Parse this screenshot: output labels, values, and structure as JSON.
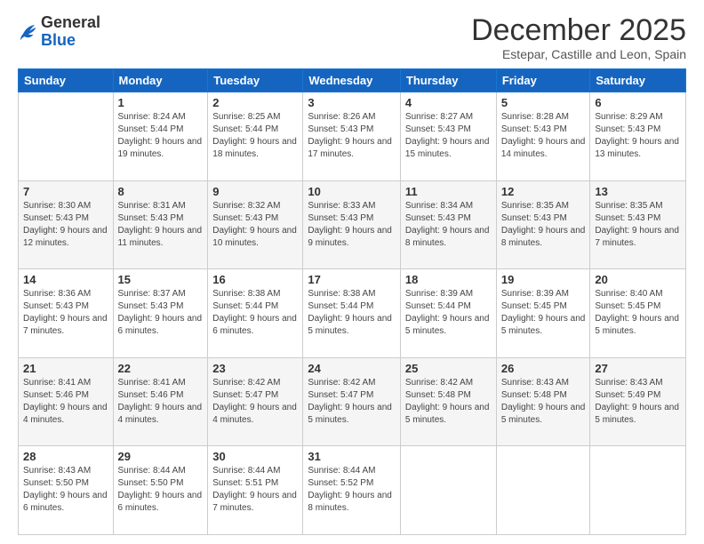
{
  "logo": {
    "general": "General",
    "blue": "Blue"
  },
  "header": {
    "month": "December 2025",
    "location": "Estepar, Castille and Leon, Spain"
  },
  "days_of_week": [
    "Sunday",
    "Monday",
    "Tuesday",
    "Wednesday",
    "Thursday",
    "Friday",
    "Saturday"
  ],
  "weeks": [
    [
      {
        "day": null
      },
      {
        "day": "1",
        "sunrise": "8:24 AM",
        "sunset": "5:44 PM",
        "daylight": "9 hours and 19 minutes."
      },
      {
        "day": "2",
        "sunrise": "8:25 AM",
        "sunset": "5:44 PM",
        "daylight": "9 hours and 18 minutes."
      },
      {
        "day": "3",
        "sunrise": "8:26 AM",
        "sunset": "5:43 PM",
        "daylight": "9 hours and 17 minutes."
      },
      {
        "day": "4",
        "sunrise": "8:27 AM",
        "sunset": "5:43 PM",
        "daylight": "9 hours and 15 minutes."
      },
      {
        "day": "5",
        "sunrise": "8:28 AM",
        "sunset": "5:43 PM",
        "daylight": "9 hours and 14 minutes."
      },
      {
        "day": "6",
        "sunrise": "8:29 AM",
        "sunset": "5:43 PM",
        "daylight": "9 hours and 13 minutes."
      }
    ],
    [
      {
        "day": "7",
        "sunrise": "8:30 AM",
        "sunset": "5:43 PM",
        "daylight": "9 hours and 12 minutes."
      },
      {
        "day": "8",
        "sunrise": "8:31 AM",
        "sunset": "5:43 PM",
        "daylight": "9 hours and 11 minutes."
      },
      {
        "day": "9",
        "sunrise": "8:32 AM",
        "sunset": "5:43 PM",
        "daylight": "9 hours and 10 minutes."
      },
      {
        "day": "10",
        "sunrise": "8:33 AM",
        "sunset": "5:43 PM",
        "daylight": "9 hours and 9 minutes."
      },
      {
        "day": "11",
        "sunrise": "8:34 AM",
        "sunset": "5:43 PM",
        "daylight": "9 hours and 8 minutes."
      },
      {
        "day": "12",
        "sunrise": "8:35 AM",
        "sunset": "5:43 PM",
        "daylight": "9 hours and 8 minutes."
      },
      {
        "day": "13",
        "sunrise": "8:35 AM",
        "sunset": "5:43 PM",
        "daylight": "9 hours and 7 minutes."
      }
    ],
    [
      {
        "day": "14",
        "sunrise": "8:36 AM",
        "sunset": "5:43 PM",
        "daylight": "9 hours and 7 minutes."
      },
      {
        "day": "15",
        "sunrise": "8:37 AM",
        "sunset": "5:43 PM",
        "daylight": "9 hours and 6 minutes."
      },
      {
        "day": "16",
        "sunrise": "8:38 AM",
        "sunset": "5:44 PM",
        "daylight": "9 hours and 6 minutes."
      },
      {
        "day": "17",
        "sunrise": "8:38 AM",
        "sunset": "5:44 PM",
        "daylight": "9 hours and 5 minutes."
      },
      {
        "day": "18",
        "sunrise": "8:39 AM",
        "sunset": "5:44 PM",
        "daylight": "9 hours and 5 minutes."
      },
      {
        "day": "19",
        "sunrise": "8:39 AM",
        "sunset": "5:45 PM",
        "daylight": "9 hours and 5 minutes."
      },
      {
        "day": "20",
        "sunrise": "8:40 AM",
        "sunset": "5:45 PM",
        "daylight": "9 hours and 5 minutes."
      }
    ],
    [
      {
        "day": "21",
        "sunrise": "8:41 AM",
        "sunset": "5:46 PM",
        "daylight": "9 hours and 4 minutes."
      },
      {
        "day": "22",
        "sunrise": "8:41 AM",
        "sunset": "5:46 PM",
        "daylight": "9 hours and 4 minutes."
      },
      {
        "day": "23",
        "sunrise": "8:42 AM",
        "sunset": "5:47 PM",
        "daylight": "9 hours and 4 minutes."
      },
      {
        "day": "24",
        "sunrise": "8:42 AM",
        "sunset": "5:47 PM",
        "daylight": "9 hours and 5 minutes."
      },
      {
        "day": "25",
        "sunrise": "8:42 AM",
        "sunset": "5:48 PM",
        "daylight": "9 hours and 5 minutes."
      },
      {
        "day": "26",
        "sunrise": "8:43 AM",
        "sunset": "5:48 PM",
        "daylight": "9 hours and 5 minutes."
      },
      {
        "day": "27",
        "sunrise": "8:43 AM",
        "sunset": "5:49 PM",
        "daylight": "9 hours and 5 minutes."
      }
    ],
    [
      {
        "day": "28",
        "sunrise": "8:43 AM",
        "sunset": "5:50 PM",
        "daylight": "9 hours and 6 minutes."
      },
      {
        "day": "29",
        "sunrise": "8:44 AM",
        "sunset": "5:50 PM",
        "daylight": "9 hours and 6 minutes."
      },
      {
        "day": "30",
        "sunrise": "8:44 AM",
        "sunset": "5:51 PM",
        "daylight": "9 hours and 7 minutes."
      },
      {
        "day": "31",
        "sunrise": "8:44 AM",
        "sunset": "5:52 PM",
        "daylight": "9 hours and 8 minutes."
      },
      {
        "day": null
      },
      {
        "day": null
      },
      {
        "day": null
      }
    ]
  ],
  "labels": {
    "sunrise": "Sunrise:",
    "sunset": "Sunset:",
    "daylight": "Daylight:"
  }
}
